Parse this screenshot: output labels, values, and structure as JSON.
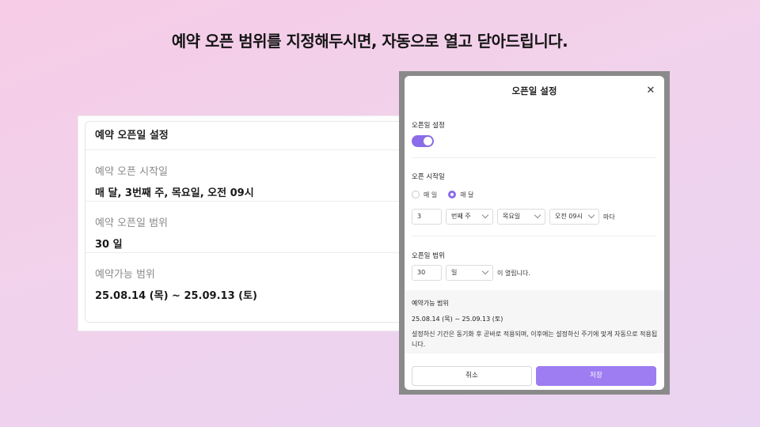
{
  "headline": "예약 오픈 범위를 지정해두시면, 자동으로 열고 닫아드립니다.",
  "left_card": {
    "title": "예약 오픈일 설정",
    "sections": [
      {
        "label": "예약 오픈 시작일",
        "value": "매 달, 3번째 주, 목요일, 오전 09시"
      },
      {
        "label": "예약 오픈일 범위",
        "value": "30 일"
      },
      {
        "label": "예약가능 범위",
        "value": "25.08.14 (목) ~ 25.09.13 (토)"
      }
    ]
  },
  "modal": {
    "title": "오픈일 설정",
    "close_icon": "close-icon",
    "open_setting_label": "오픈일 설정",
    "toggle_on": true,
    "start_label": "오픈 시작일",
    "radio_options": [
      "매 일",
      "매 달"
    ],
    "radio_selected": "매 달",
    "week_number": "3",
    "week_select": "번째 주",
    "weekday_select": "목요일",
    "time_select": "오전 09시",
    "suffix_every": "마다",
    "range_label": "오픈일 범위",
    "range_value": "30",
    "range_unit": "일",
    "range_suffix": "이 열립니다.",
    "available_title": "예약가능 범위",
    "available_range": "25.08.14 (목) ~ 25.09.13 (토)",
    "note": "설정하신 기간은 동기화 후 곧바로 적용되며, 이후에는 설정하신 주기에 맞게 자동으로 적용됩니다.",
    "cancel_label": "취소",
    "save_label": "저장"
  },
  "colors": {
    "accent": "#8b6be8",
    "save_button": "#9e7cf2",
    "overlay": "#8a8a8a"
  }
}
